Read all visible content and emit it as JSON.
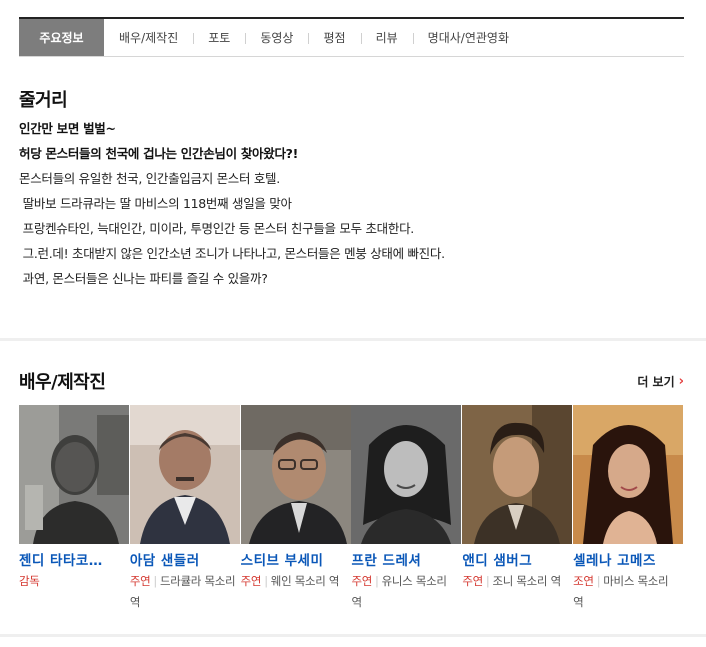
{
  "tabs": [
    {
      "label": "주요정보",
      "active": true
    },
    {
      "label": "배우/제작진"
    },
    {
      "label": "포토"
    },
    {
      "label": "동영상"
    },
    {
      "label": "평점"
    },
    {
      "label": "리뷰"
    },
    {
      "label": "명대사/연관영화"
    }
  ],
  "synopsis": {
    "title": "줄거리",
    "lines": [
      {
        "text": "인간만 보면 벌벌~",
        "bold": true
      },
      {
        "text": "허당 몬스터들의 천국에 겁나는 인간손님이 찾아왔다?!",
        "bold": true
      },
      {
        "text": "몬스터들의 유일한 천국, 인간출입금지 몬스터 호텔."
      },
      {
        "text": " 딸바보 드라큐라는 딸 마비스의 118번째 생일을 맞아"
      },
      {
        "text": " 프랑켄슈타인, 늑대인간, 미이라, 투명인간 등 몬스터 친구들을 모두 초대한다."
      },
      {
        "text": ""
      },
      {
        "text": " 그.런.데! 초대받지 않은 인간소년 조니가 나타나고, 몬스터들은 멘붕 상태에 빠진다."
      },
      {
        "text": " 과연, 몬스터들은 신나는 파티를 즐길 수 있을까?"
      }
    ]
  },
  "cast_section": {
    "title": "배우/제작진",
    "more_label": "더 보기"
  },
  "cast": [
    {
      "name": "젠디 타타코…",
      "role_type": "감독",
      "role_text": ""
    },
    {
      "name": "아담 샌들러",
      "role_type": "주연",
      "role_text": "드라큘라 목소리 역"
    },
    {
      "name": "스티브 부세미",
      "role_type": "주연",
      "role_text": "웨인 목소리 역"
    },
    {
      "name": "프란 드레셔",
      "role_type": "주연",
      "role_text": "유니스 목소리 역"
    },
    {
      "name": "앤디 샘버그",
      "role_type": "주연",
      "role_text": "조니 목소리 역"
    },
    {
      "name": "셀레나 고메즈",
      "role_type": "조연",
      "role_text": "마비스 목소리 역"
    }
  ],
  "colors": {
    "active_tab": "#7d7d7d",
    "cast_name": "#0a57b8",
    "role_type": "#d4372f",
    "more_chevron": "#e34040"
  }
}
